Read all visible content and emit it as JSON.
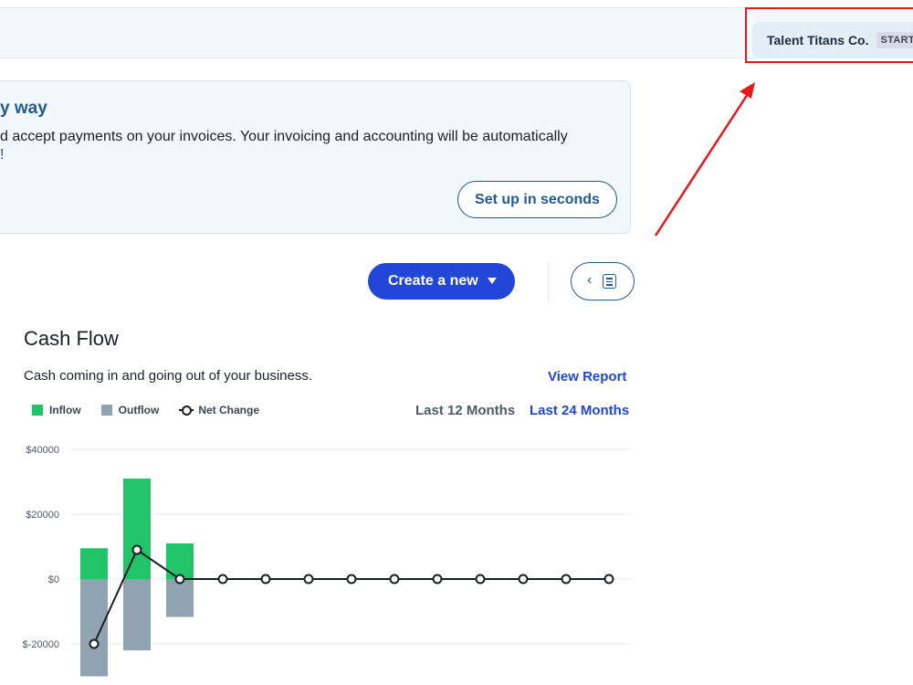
{
  "topbar": {
    "business_name": "Talent Titans Co.",
    "plan_badge": "STARTER"
  },
  "banner": {
    "title": "y way",
    "text_line1": "d accept payments on your invoices. Your invoicing and accounting will be automatically",
    "text_line2": "!",
    "setup_button": "Set up in seconds"
  },
  "actions": {
    "create_button": "Create a new"
  },
  "cash_flow": {
    "title": "Cash Flow",
    "subtitle": "Cash coming in and going out of your business.",
    "view_report": "View Report",
    "period_12": "Last 12 Months",
    "period_24": "Last 24 Months",
    "legend": {
      "inflow": "Inflow",
      "outflow": "Outflow",
      "net_change": "Net Change"
    }
  },
  "colors": {
    "inflow": "#22c46a",
    "outflow": "#8fa3b1",
    "net_line": "#1b1f24",
    "accent": "#2146d8",
    "annotation": "#e31b1b"
  },
  "chart_data": {
    "type": "bar",
    "y_ticks": [
      "$40000",
      "$20000",
      "$0",
      "$-20000"
    ],
    "y_tick_values": [
      40000,
      20000,
      0,
      -20000
    ],
    "ylim": [
      -30000,
      40000
    ],
    "series": [
      {
        "name": "Inflow",
        "values": [
          9500,
          31000,
          11000,
          0,
          0,
          0,
          0,
          0,
          0,
          0,
          0,
          0,
          0
        ]
      },
      {
        "name": "Outflow",
        "values": [
          -30000,
          -22000,
          -11700,
          0,
          0,
          0,
          0,
          0,
          0,
          0,
          0,
          0,
          0
        ]
      },
      {
        "name": "Net Change",
        "values": [
          -20000,
          9000,
          0,
          0,
          0,
          0,
          0,
          0,
          0,
          0,
          0,
          0,
          0
        ]
      }
    ]
  }
}
